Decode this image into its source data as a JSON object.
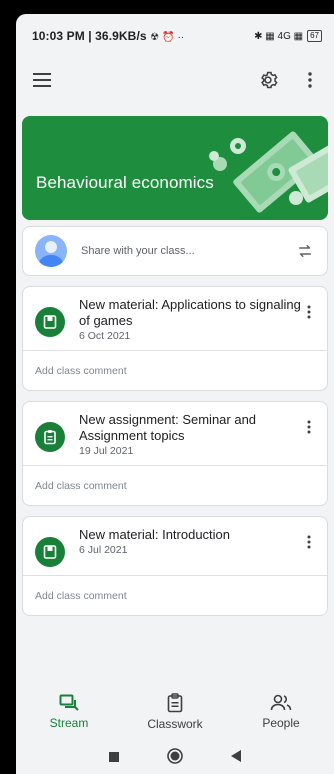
{
  "status_bar": {
    "time_speed": "10:03 PM | 36.9KB/s",
    "extra_icons": "☢ ⏰ ··",
    "right_icons": "✱ ▦ 4G ▦",
    "battery": "67"
  },
  "app_bar": {
    "menu_icon": "hamburger-menu-icon",
    "settings_icon": "gear-icon",
    "more_icon": "vertical-more-icon"
  },
  "banner": {
    "title": "Behavioural economics",
    "color": "#1e8e3e"
  },
  "share": {
    "placeholder": "Share with your class...",
    "repost_icon": "repost-arrows-icon"
  },
  "posts": [
    {
      "type": "material",
      "icon": "material-book-icon",
      "title": "New material: Applications to signaling of games",
      "date": "6 Oct 2021",
      "comment_label": "Add class comment"
    },
    {
      "type": "assignment",
      "icon": "assignment-clipboard-icon",
      "title": "New assignment: Seminar and Assignment topics",
      "date": "19 Jul 2021",
      "comment_label": "Add class comment"
    },
    {
      "type": "material",
      "icon": "material-book-icon",
      "title": "New material: Introduction",
      "date": "6 Jul 2021",
      "comment_label": "Add class comment"
    }
  ],
  "bottom_nav": {
    "items": [
      {
        "label": "Stream",
        "icon": "stream-chat-icon",
        "active": true
      },
      {
        "label": "Classwork",
        "icon": "classwork-clipboard-icon",
        "active": false
      },
      {
        "label": "People",
        "icon": "people-icon",
        "active": false
      }
    ]
  },
  "accent_color": "#188038"
}
